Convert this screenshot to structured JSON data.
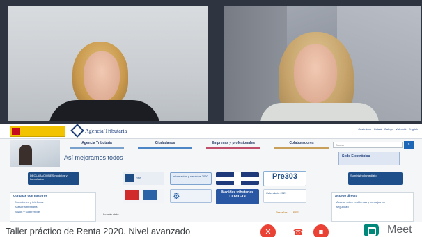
{
  "site": {
    "brand": "Agencia Tributaria",
    "header_links": "Castellano · Català · Galego · Valencià · English",
    "nav": [
      "Agencia Tributaria",
      "Ciudadanos",
      "Empresas y profesionales",
      "Colaboradores"
    ],
    "search_placeholder": "Buscar",
    "search_icon": "search-icon",
    "hero_text": "Así mejoramos todos",
    "sede_label": "Sede Electrónica",
    "tiles": {
      "declaraciones": "DECLARACIONES modelos y formularios",
      "rpa": "RPA",
      "campana": "Información y servicios 2020",
      "covid": "Medidas tributarias COVID-19",
      "pre": "Pre303",
      "calendario": "Calendario 2021",
      "right": "Suministro Inmediato"
    },
    "contact_box": {
      "title": "Contacte con nosotros",
      "lines": [
        "Direcciones y teléfonos",
        "Asesoría tributaria",
        "Buzón y sugerencias"
      ]
    },
    "access_box": {
      "title": "Acceso directo",
      "lines": [
        "Acceso sobre problemas y consejos en",
        "seguridad"
      ]
    },
    "mid_note": "Lo más visto",
    "mid_links": [
      "Pestañas",
      "RSS"
    ]
  },
  "meeting": {
    "title": "Taller práctico de Renta 2020. Nivel avanzado",
    "mic_icon": "mic-off-icon",
    "hangup_icon": "hangup-icon",
    "camera_icon": "camera-off-icon",
    "app_name": "Meet",
    "accent": "#ea4335",
    "brand_color": "#00897b"
  }
}
